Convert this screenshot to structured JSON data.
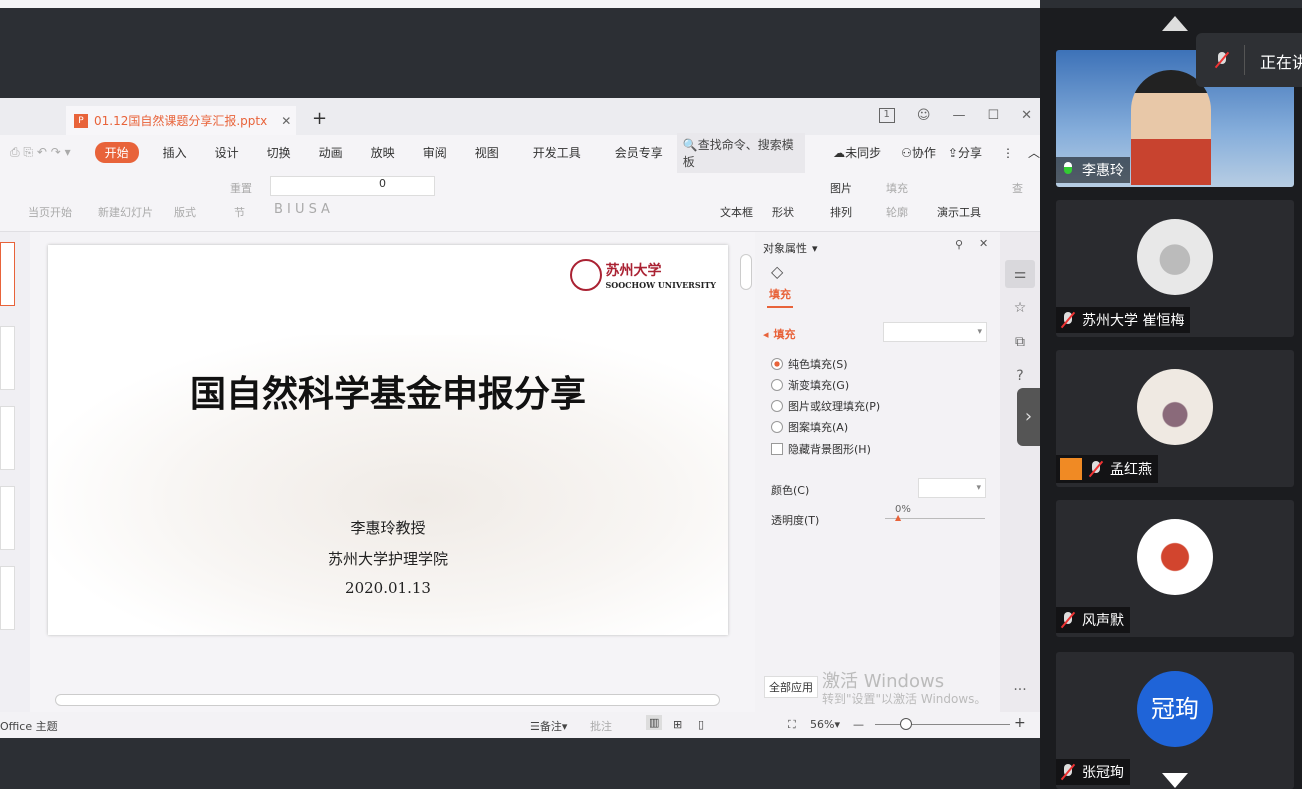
{
  "wps": {
    "tab_title": "01.12国自然课题分享汇报.pptx",
    "tab_icon": "P",
    "menu": [
      "开始",
      "插入",
      "设计",
      "切换",
      "动画",
      "放映",
      "审阅",
      "视图",
      "开发工具",
      "会员专享"
    ],
    "search_placeholder": "查找命令、搜索模板",
    "right_menu": [
      "未同步",
      "协作",
      "分享"
    ],
    "page_indicator": "1",
    "ribbon": {
      "play_from_current": "当页开始",
      "new_slide": "新建幻灯片",
      "layout": "版式",
      "section": "节",
      "reset": "重置",
      "font_size": "0",
      "textbox": "文本框",
      "shape": "形状",
      "picture": "图片",
      "fill": "填充",
      "arrange": "排列",
      "outline": "轮廓",
      "presenter_tools": "演示工具",
      "find": "查"
    },
    "slide": {
      "logo_cn": "苏州大学",
      "logo_en": "SOOCHOW UNIVERSITY",
      "title": "国自然科学基金申报分享",
      "presenter": "李惠玲教授",
      "affiliation": "苏州大学护理学院",
      "date": "2020.01.13"
    },
    "panel": {
      "header": "对象属性",
      "tab": "填充",
      "section": "填充",
      "options": [
        "纯色填充(S)",
        "渐变填充(G)",
        "图片或纹理填充(P)",
        "图案填充(A)"
      ],
      "selected_option": 0,
      "hide_bg": "隐藏背景图形(H)",
      "color_label": "颜色(C)",
      "transparency_label": "透明度(T)",
      "transparency_value": "0%",
      "apply_all": "全部应用"
    },
    "watermark": {
      "line1": "激活 Windows",
      "line2": "转到\"设置\"以激活 Windows。"
    },
    "status": {
      "theme": "Office 主题",
      "notes": "备注",
      "comments": "批注",
      "zoom": "56%"
    }
  },
  "meeting": {
    "speaking_label": "正在讲话",
    "participants": [
      {
        "name": "李惠玲",
        "mic": "live"
      },
      {
        "name": "苏州大学 崔恒梅",
        "mic": "muted"
      },
      {
        "name": "孟红燕",
        "mic": "muted"
      },
      {
        "name": "风声默",
        "mic": "muted"
      },
      {
        "name": "张冠珣",
        "mic": "muted",
        "avatar_text": "冠珣"
      }
    ]
  }
}
